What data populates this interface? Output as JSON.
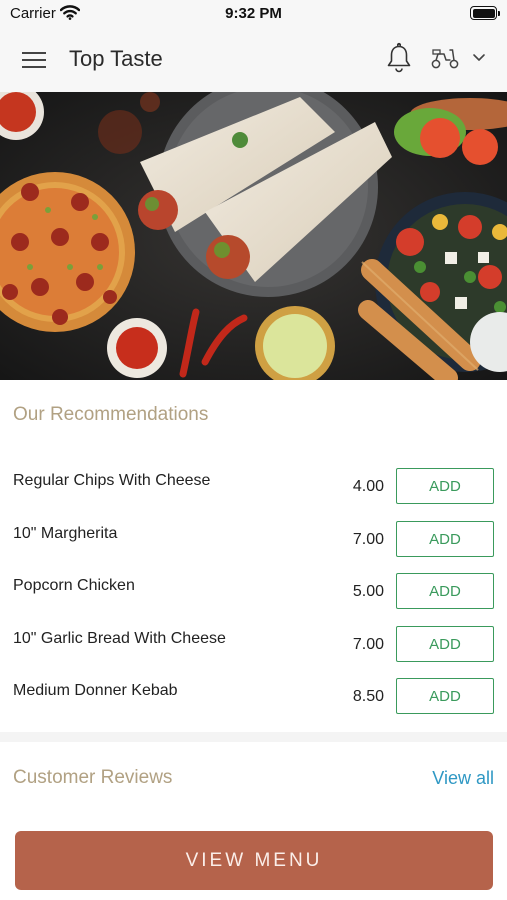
{
  "status_bar": {
    "carrier": "Carrier",
    "time": "9:32 PM"
  },
  "header": {
    "title": "Top Taste"
  },
  "icons": {
    "menu": "menu-icon",
    "notifications": "bell-icon",
    "delivery_mode": "scooter-icon",
    "dropdown": "chevron-down-icon"
  },
  "recommendations": {
    "title": "Our Recommendations",
    "add_label": "ADD",
    "items": [
      {
        "name": "Regular Chips With Cheese",
        "price": "4.00"
      },
      {
        "name": "10\" Margherita",
        "price": "7.00"
      },
      {
        "name": "Popcorn Chicken",
        "price": "5.00"
      },
      {
        "name": "10\" Garlic Bread With Cheese",
        "price": "7.00"
      },
      {
        "name": "Medium Donner Kebab",
        "price": "8.50"
      }
    ]
  },
  "reviews": {
    "title": "Customer Reviews",
    "view_all": "View all"
  },
  "footer": {
    "view_menu_label": "VIEW MENU"
  },
  "colors": {
    "accent_gold": "#b1a183",
    "add_green": "#3a9a5c",
    "link_blue": "#2f98c4",
    "cta_terracotta": "#b5634b"
  }
}
